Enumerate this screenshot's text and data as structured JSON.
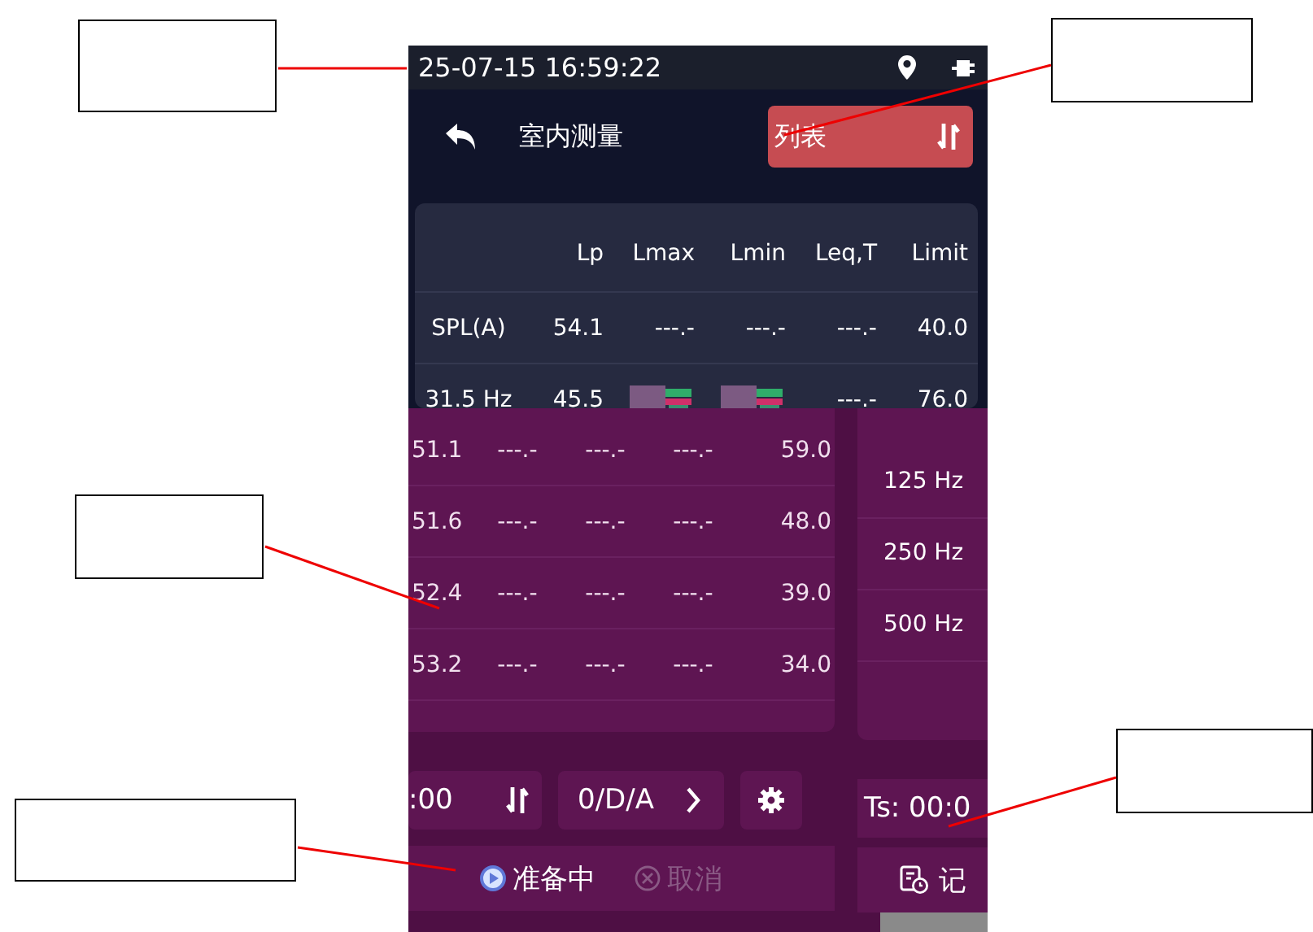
{
  "status_bar": {
    "datetime": "25-07-15 16:59:22"
  },
  "header": {
    "title": "室内测量",
    "view_button": "列表"
  },
  "table": {
    "columns": [
      "Lp",
      "Lmax",
      "Lmin",
      "Leq,T",
      "Limit"
    ],
    "rows": [
      {
        "label": "SPL(A)",
        "cells": [
          "54.1",
          "---.-",
          "---.-",
          "---.-",
          "40.0"
        ]
      },
      {
        "label": "31.5 Hz",
        "cells": [
          "45.5",
          null,
          null,
          "---.-",
          "76.0"
        ]
      }
    ]
  },
  "band_rows": [
    {
      "cells": [
        "51.1",
        "---.-",
        "---.-",
        "---.-",
        "59.0"
      ]
    },
    {
      "cells": [
        "51.6",
        "---.-",
        "---.-",
        "---.-",
        "48.0"
      ]
    },
    {
      "cells": [
        "52.4",
        "---.-",
        "---.-",
        "---.-",
        "39.0"
      ]
    },
    {
      "cells": [
        "53.2",
        "---.-",
        "---.-",
        "---.-",
        "34.0"
      ]
    }
  ],
  "bands": [
    "125 Hz",
    "250 Hz",
    "500 Hz"
  ],
  "controls": {
    "time": ":00",
    "mode": "0/D/A",
    "ts": "Ts: 00:0"
  },
  "actions": [
    {
      "kind": "start",
      "label": "准备中",
      "disabled": false
    },
    {
      "kind": "cancel",
      "label": "取消",
      "disabled": true
    }
  ],
  "record": "记"
}
